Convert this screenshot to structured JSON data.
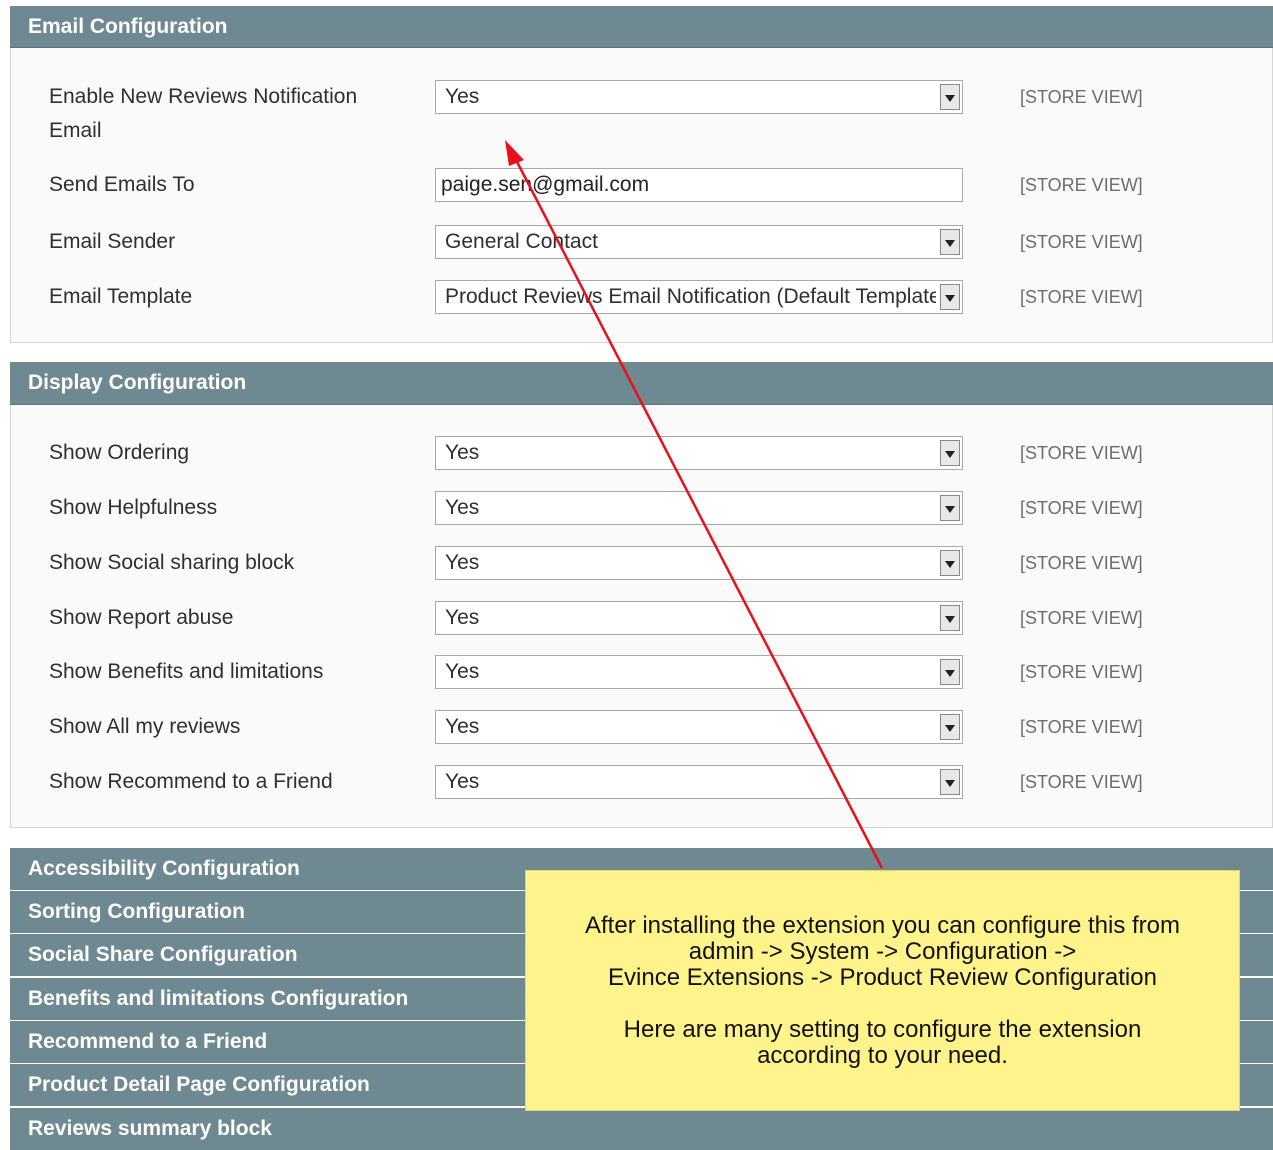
{
  "email_config": {
    "title": "Email Configuration",
    "rows": [
      {
        "label_line1": "Enable New Reviews Notification",
        "label_line2": "Email",
        "value": "Yes",
        "scope": "[STORE VIEW]"
      },
      {
        "label": "Send Emails To",
        "value": "paige.sen@gmail.com",
        "scope": "[STORE VIEW]"
      },
      {
        "label": "Email Sender",
        "value": "General Contact",
        "scope": "[STORE VIEW]"
      },
      {
        "label": "Email Template",
        "value": "Product Reviews Email Notification (Default Template)",
        "scope": "[STORE VIEW]"
      }
    ]
  },
  "display_config": {
    "title": "Display Configuration",
    "rows": [
      {
        "label": "Show Ordering",
        "value": "Yes",
        "scope": "[STORE VIEW]"
      },
      {
        "label": "Show Helpfulness",
        "value": "Yes",
        "scope": "[STORE VIEW]"
      },
      {
        "label": "Show Social sharing block",
        "value": "Yes",
        "scope": "[STORE VIEW]"
      },
      {
        "label": "Show Report abuse",
        "value": "Yes",
        "scope": "[STORE VIEW]"
      },
      {
        "label": "Show Benefits and limitations",
        "value": "Yes",
        "scope": "[STORE VIEW]"
      },
      {
        "label": "Show All my reviews",
        "value": "Yes",
        "scope": "[STORE VIEW]"
      },
      {
        "label": "Show Recommend to a Friend",
        "value": "Yes",
        "scope": "[STORE VIEW]"
      }
    ]
  },
  "collapsed_sections": [
    "Accessibility Configuration",
    "Sorting Configuration",
    "Social Share Configuration",
    "Benefits and limitations Configuration",
    "Recommend to a Friend",
    "Product Detail Page Configuration",
    "Reviews summary block"
  ],
  "note": {
    "line1": "After installing the extension you can configure this from",
    "line2": "admin -> System -> Configuration ->",
    "line3": "Evince Extensions -> Product Review Configuration",
    "line4": "Here are many setting to configure the extension",
    "line5": "according to your need."
  },
  "colors": {
    "header_bg": "#6f8992",
    "note_bg": "#fff48c",
    "arrow": "#e8101a"
  }
}
